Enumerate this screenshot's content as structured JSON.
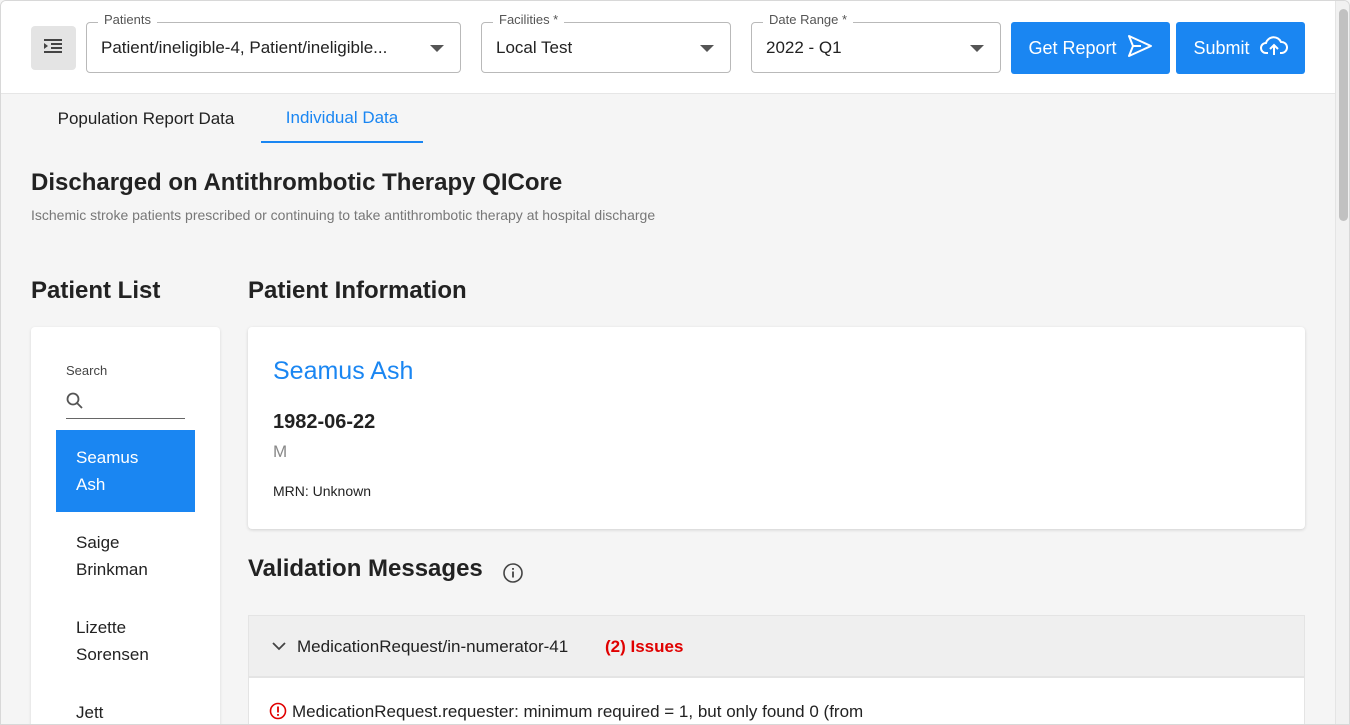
{
  "header": {
    "patients": {
      "label": "Patients",
      "value": "Patient/ineligible-4, Patient/ineligible..."
    },
    "facilities": {
      "label": "Facilities *",
      "value": "Local Test"
    },
    "date_range": {
      "label": "Date Range *",
      "value": "2022 - Q1"
    },
    "get_report_label": "Get Report",
    "submit_label": "Submit"
  },
  "tabs": [
    {
      "label": "Population Report Data",
      "active": false
    },
    {
      "label": "Individual Data",
      "active": true
    }
  ],
  "measure": {
    "title": "Discharged on Antithrombotic Therapy QICore",
    "description": "Ischemic stroke patients prescribed or continuing to take antithrombotic therapy at hospital discharge"
  },
  "patient_list": {
    "title": "Patient List",
    "search_label": "Search",
    "items": [
      {
        "first": "Seamus",
        "last": "Ash",
        "selected": true
      },
      {
        "first": "Saige",
        "last": "Brinkman",
        "selected": false
      },
      {
        "first": "Lizette",
        "last": "Sorensen",
        "selected": false
      },
      {
        "first": "Jett",
        "last": "",
        "selected": false
      }
    ]
  },
  "patient_info": {
    "title": "Patient Information",
    "name": "Seamus Ash",
    "dob": "1982-06-22",
    "sex": "M",
    "mrn": "MRN: Unknown"
  },
  "validation": {
    "title": "Validation Messages",
    "resource": "MedicationRequest/in-numerator-41",
    "issue_count": "(2) Issues",
    "message": "MedicationRequest.requester: minimum required = 1, but only found 0 (from"
  },
  "colors": {
    "accent": "#1a86f2",
    "error": "#e00000"
  }
}
